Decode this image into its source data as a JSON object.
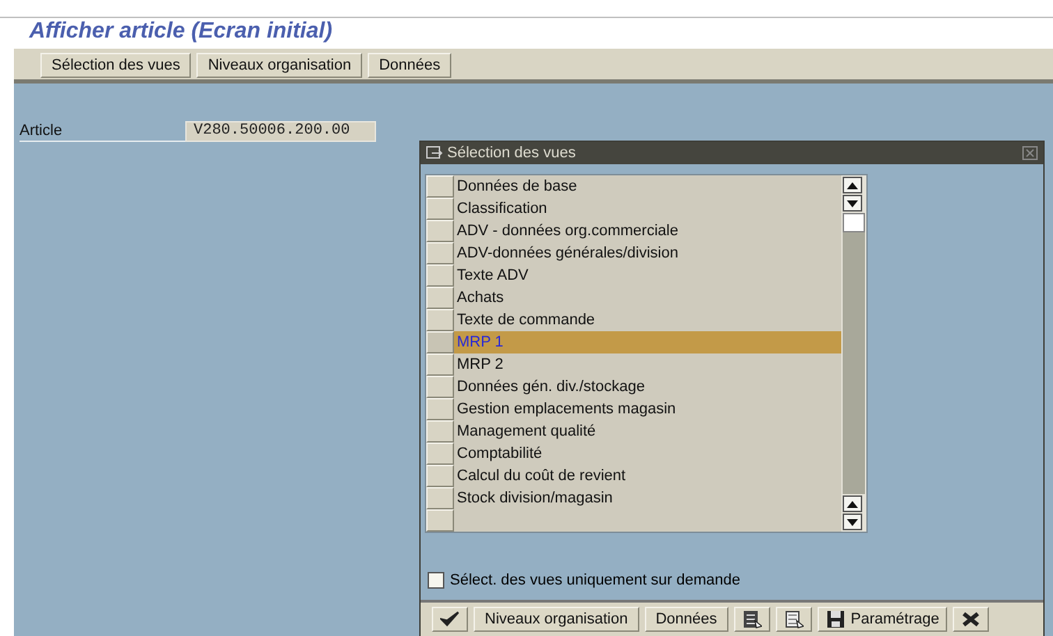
{
  "title": "Afficher article (Ecran initial)",
  "toolbar": [
    {
      "label": "Sélection des vues"
    },
    {
      "label": "Niveaux organisation"
    },
    {
      "label": "Données"
    }
  ],
  "article": {
    "label": "Article",
    "value": "V280.50006.200.00"
  },
  "dialog": {
    "title": "Sélection des vues",
    "views": [
      {
        "label": "Données de base",
        "selected": false
      },
      {
        "label": "Classification",
        "selected": false
      },
      {
        "label": "ADV - données org.commerciale",
        "selected": false
      },
      {
        "label": "ADV-données générales/division",
        "selected": false
      },
      {
        "label": "Texte ADV",
        "selected": false
      },
      {
        "label": "Achats",
        "selected": false
      },
      {
        "label": "Texte de commande",
        "selected": false
      },
      {
        "label": "MRP 1",
        "selected": true
      },
      {
        "label": "MRP 2",
        "selected": false
      },
      {
        "label": "Données gén. div./stockage",
        "selected": false
      },
      {
        "label": "Gestion emplacements magasin",
        "selected": false
      },
      {
        "label": "Management qualité",
        "selected": false
      },
      {
        "label": "Comptabilité",
        "selected": false
      },
      {
        "label": "Calcul du coût de revient",
        "selected": false
      },
      {
        "label": "Stock division/magasin",
        "selected": false
      }
    ],
    "on_demand": {
      "label": "Sélect. des vues uniquement sur demande",
      "checked": false
    },
    "buttons": [
      {
        "kind": "confirm"
      },
      {
        "kind": "text",
        "label": "Niveaux organisation"
      },
      {
        "kind": "text",
        "label": "Données"
      },
      {
        "kind": "select-all"
      },
      {
        "kind": "deselect-all"
      },
      {
        "kind": "save",
        "label": "Paramétrage"
      },
      {
        "kind": "cancel"
      }
    ]
  }
}
